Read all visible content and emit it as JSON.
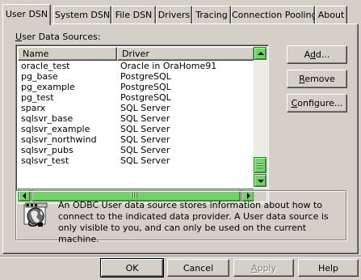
{
  "tabs": [
    {
      "label": "User DSN",
      "active": true
    },
    {
      "label": "System DSN"
    },
    {
      "label": "File DSN"
    },
    {
      "label": "Drivers"
    },
    {
      "label": "Tracing"
    },
    {
      "label": "Connection Pooling"
    },
    {
      "label": "About"
    }
  ],
  "section_label": {
    "mnemonic": "U",
    "rest": "ser Data Sources:"
  },
  "list": {
    "columns": [
      "Name",
      "Driver"
    ],
    "rows": [
      {
        "name": "oracle_test",
        "driver": "Oracle in OraHome91"
      },
      {
        "name": "pg_base",
        "driver": "PostgreSQL"
      },
      {
        "name": "pg_example",
        "driver": "PostgreSQL"
      },
      {
        "name": "pg_test",
        "driver": "PostgreSQL"
      },
      {
        "name": "sparx",
        "driver": "SQL Server"
      },
      {
        "name": "sqlsvr_base",
        "driver": "SQL Server"
      },
      {
        "name": "sqlsvr_example",
        "driver": "SQL Server"
      },
      {
        "name": "sqlsvr_northwind",
        "driver": "SQL Server"
      },
      {
        "name": "sqlsvr_pubs",
        "driver": "SQL Server"
      },
      {
        "name": "sqlsvr_test",
        "driver": "SQL Server"
      }
    ]
  },
  "side_buttons": {
    "add": {
      "pre": "A",
      "mnemonic": "d",
      "post": "d..."
    },
    "remove": {
      "pre": "",
      "mnemonic": "R",
      "post": "emove"
    },
    "configure": {
      "pre": "",
      "mnemonic": "C",
      "post": "onfigure..."
    }
  },
  "info": {
    "icon": "odbc-globe-icon",
    "text": "An ODBC User data source stores information about how to connect to the indicated data provider.   A User data source is only visible to you, and can only be used on the current machine."
  },
  "footer_buttons": {
    "ok": "OK",
    "cancel": "Cancel",
    "apply": {
      "mnemonic": "A",
      "rest": "pply"
    },
    "help": "Help"
  },
  "colors": {
    "face": "#d4d0c8",
    "scroll_thumb": "#73d16b"
  }
}
